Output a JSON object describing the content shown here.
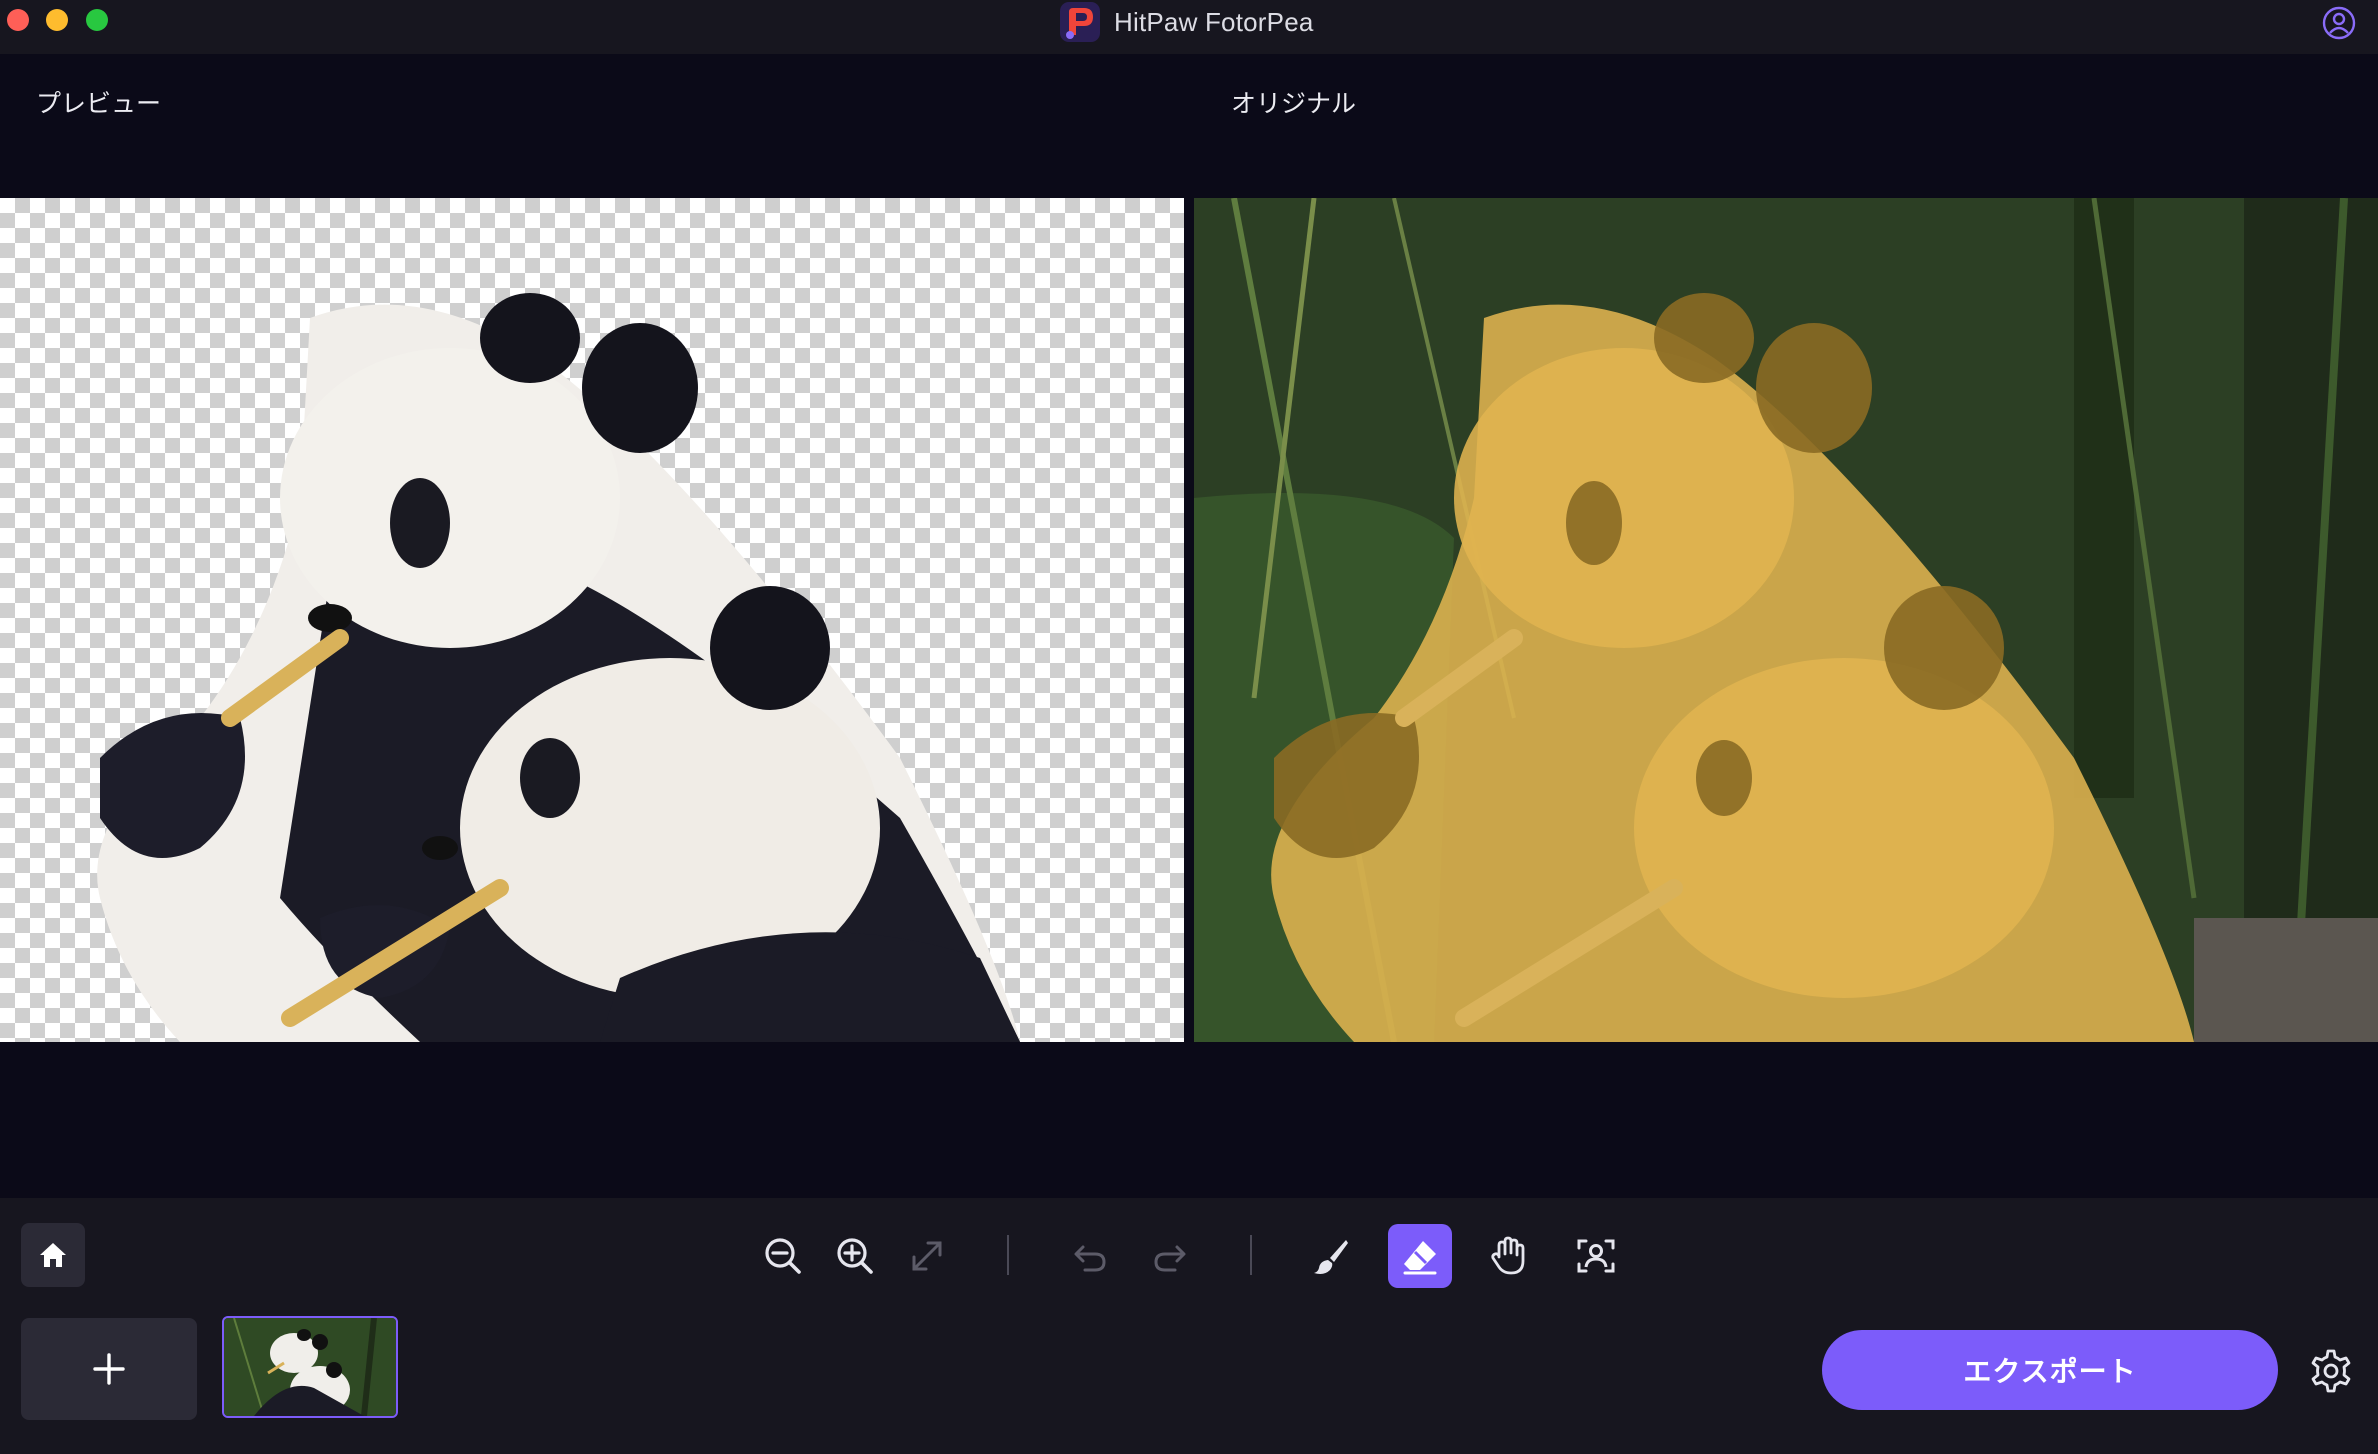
{
  "app": {
    "title": "HitPaw FotorPea",
    "logo_icon": "hitpaw-logo-icon",
    "account_icon": "user-account-icon"
  },
  "workspace": {
    "preview_label": "プレビュー",
    "original_label": "オリジナル",
    "mask_color": "#e0b450"
  },
  "toolbar": {
    "home_icon": "home-icon",
    "tools": [
      {
        "name": "zoom-out-icon",
        "enabled": true
      },
      {
        "name": "zoom-in-icon",
        "enabled": true
      },
      {
        "name": "fit-screen-icon",
        "enabled": false
      },
      {
        "name": "undo-icon",
        "enabled": false
      },
      {
        "name": "redo-icon",
        "enabled": false
      },
      {
        "name": "brush-icon",
        "enabled": true
      },
      {
        "name": "eraser-icon",
        "enabled": true,
        "active": true
      },
      {
        "name": "hand-pan-icon",
        "enabled": true
      },
      {
        "name": "subject-select-icon",
        "enabled": true
      }
    ],
    "add_icon": "plus-icon",
    "export_label": "エクスポート",
    "settings_icon": "gear-icon",
    "accent_color": "#7c5cfa"
  }
}
